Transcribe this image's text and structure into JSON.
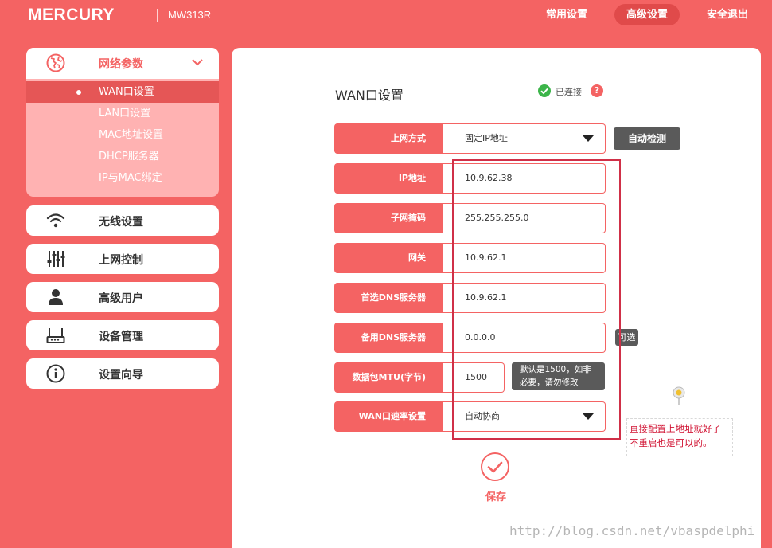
{
  "header": {
    "brand": "MERCURY",
    "model": "MW313R",
    "nav": {
      "common": "常用设置",
      "advanced": "高级设置",
      "logout": "安全退出"
    }
  },
  "sidebar": {
    "group": {
      "label": "网络参数",
      "items": [
        {
          "label": "WAN口设置",
          "active": true
        },
        {
          "label": "LAN口设置"
        },
        {
          "label": "MAC地址设置"
        },
        {
          "label": "DHCP服务器"
        },
        {
          "label": "IP与MAC绑定"
        }
      ]
    },
    "items": [
      {
        "label": "无线设置",
        "icon": "wifi-icon"
      },
      {
        "label": "上网控制",
        "icon": "sliders-icon"
      },
      {
        "label": "高级用户",
        "icon": "user-icon"
      },
      {
        "label": "设备管理",
        "icon": "router-icon"
      },
      {
        "label": "设置向导",
        "icon": "info-icon"
      }
    ]
  },
  "main": {
    "title": "WAN口设置",
    "status": {
      "text": "已连接",
      "help": "?"
    },
    "detect_button": "自动检测",
    "optional_tag": "可选",
    "mtu_tip": [
      "默认是1500，如非",
      "必要，请勿修改"
    ],
    "fields": [
      {
        "label": "上网方式",
        "value": "固定IP地址",
        "type": "select"
      },
      {
        "label": "IP地址",
        "value": "10.9.62.38",
        "type": "text"
      },
      {
        "label": "子网掩码",
        "value": "255.255.255.0",
        "type": "text"
      },
      {
        "label": "网关",
        "value": "10.9.62.1",
        "type": "text"
      },
      {
        "label": "首选DNS服务器",
        "value": "10.9.62.1",
        "type": "text"
      },
      {
        "label": "备用DNS服务器",
        "value": "0.0.0.0",
        "type": "text"
      },
      {
        "label": "数据包MTU(字节)",
        "value": "1500",
        "type": "text"
      },
      {
        "label": "WAN口速率设置",
        "value": "自动协商",
        "type": "select"
      }
    ],
    "annotation": [
      "直接配置上地址就好了",
      "不重启也是可以的。"
    ],
    "save_label": "保存"
  },
  "watermark": "http://blog.csdn.net/vbaspdelphi",
  "colors": {
    "accent": "#f46363",
    "dark_button": "#5a5a5a",
    "connected": "#3cb54a"
  }
}
